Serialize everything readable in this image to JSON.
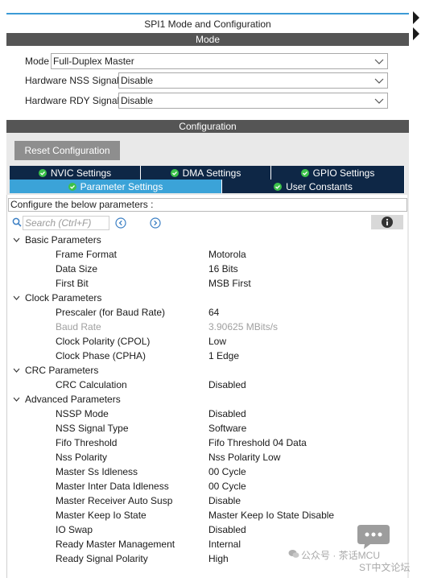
{
  "window": {
    "title": "SPI1 Mode and Configuration"
  },
  "mode": {
    "header": "Mode",
    "rows": [
      {
        "label": "Mode",
        "value": "Full-Duplex Master"
      },
      {
        "label": "Hardware NSS Signal",
        "value": "Disable"
      },
      {
        "label": "Hardware RDY Signal",
        "value": "Disable"
      }
    ]
  },
  "configuration": {
    "header": "Configuration",
    "reset_label": "Reset Configuration",
    "tabs_row1": [
      {
        "label": "NVIC Settings"
      },
      {
        "label": "DMA Settings"
      },
      {
        "label": "GPIO Settings"
      }
    ],
    "tabs_row2": [
      {
        "label": "Parameter Settings",
        "active": true
      },
      {
        "label": "User Constants",
        "active": false
      }
    ],
    "hint": "Configure the below parameters :",
    "search_placeholder": "Search (Ctrl+F)"
  },
  "groups": [
    {
      "name": "Basic Parameters",
      "params": [
        {
          "name": "Frame Format",
          "value": "Motorola"
        },
        {
          "name": "Data Size",
          "value": "16 Bits"
        },
        {
          "name": "First Bit",
          "value": "MSB First"
        }
      ]
    },
    {
      "name": "Clock Parameters",
      "params": [
        {
          "name": "Prescaler (for Baud Rate)",
          "value": "64"
        },
        {
          "name": "Baud Rate",
          "value": "3.90625 MBits/s",
          "disabled": true
        },
        {
          "name": "Clock Polarity (CPOL)",
          "value": "Low"
        },
        {
          "name": "Clock Phase (CPHA)",
          "value": "1 Edge"
        }
      ]
    },
    {
      "name": "CRC Parameters",
      "params": [
        {
          "name": "CRC Calculation",
          "value": "Disabled"
        }
      ]
    },
    {
      "name": "Advanced Parameters",
      "params": [
        {
          "name": "NSSP Mode",
          "value": "Disabled"
        },
        {
          "name": "NSS Signal Type",
          "value": "Software"
        },
        {
          "name": "Fifo Threshold",
          "value": "Fifo Threshold 04 Data"
        },
        {
          "name": "Nss Polarity",
          "value": "Nss Polarity Low"
        },
        {
          "name": "Master Ss Idleness",
          "value": "00 Cycle"
        },
        {
          "name": "Master Inter Data Idleness",
          "value": "00 Cycle"
        },
        {
          "name": "Master Receiver Auto Susp",
          "value": "Disable"
        },
        {
          "name": "Master Keep Io State",
          "value": "Master Keep Io State Disable"
        },
        {
          "name": "IO Swap",
          "value": "Disabled"
        },
        {
          "name": "Ready Master Management",
          "value": "Internal"
        },
        {
          "name": "Ready Signal Polarity",
          "value": "High"
        }
      ]
    }
  ],
  "watermark": {
    "line1": "公众号 · 茶话MCU",
    "line2": "ST中文论坛"
  },
  "colors": {
    "tab_dark": "#0e2746",
    "tab_active": "#3ba3d8",
    "bar_gray": "#555555",
    "check_green": "#3cc24a"
  }
}
